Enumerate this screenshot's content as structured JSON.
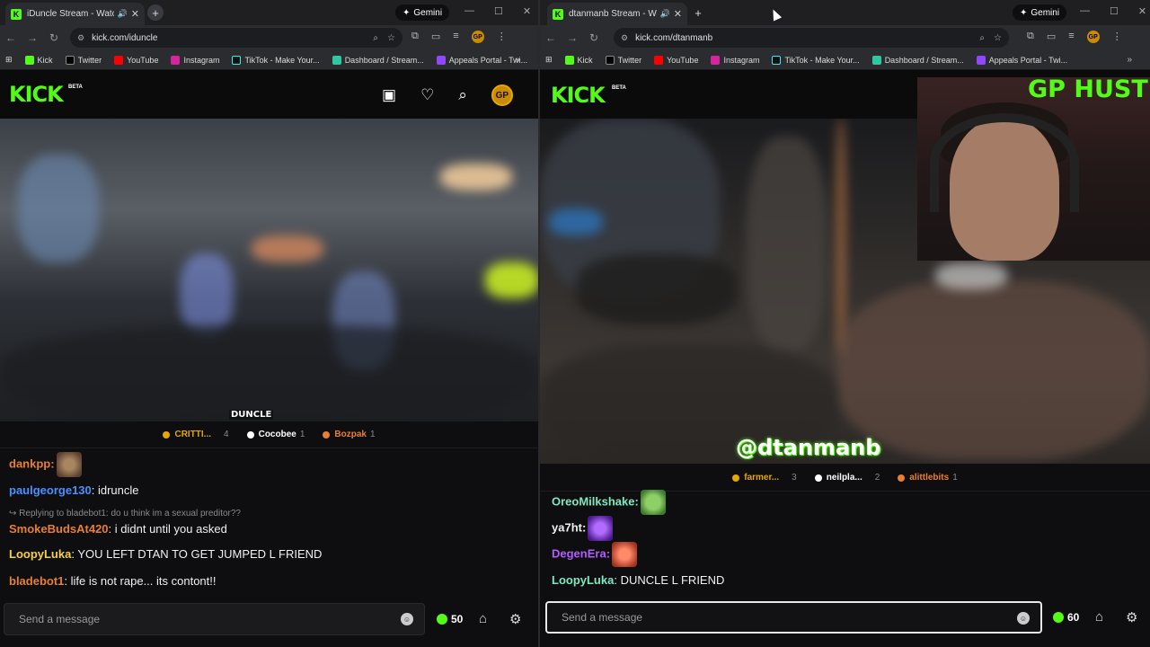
{
  "left": {
    "tab": {
      "title": "iDuncle Stream - Watch Live",
      "favicon": "K"
    },
    "gemini": "Gemini",
    "url": "kick.com/iduncle",
    "bookmarks": [
      "Kick",
      "Twitter",
      "YouTube",
      "Instagram",
      "TikTok - Make Your...",
      "Dashboard / Stream...",
      "Appeals Portal - Twi..."
    ],
    "logo": "KICK",
    "beta": "BETA",
    "watermark": "DUNCLE",
    "top_chatters": [
      {
        "name": "CRITTI...",
        "count": "4",
        "color": "#e6a700"
      },
      {
        "name": "Cocobee",
        "count": "1",
        "color": "#ffffff"
      },
      {
        "name": "Bozpak",
        "count": "1",
        "color": "#e87f2c"
      }
    ],
    "chat": [
      {
        "user": "dankpp:",
        "text": "",
        "color": "#e87f2c",
        "emote": true
      },
      {
        "user": "paulgeorge130",
        "text": ": idruncle",
        "color": "#4a90ff"
      },
      {
        "reply": "Replying to bladebot1: do u think im a sexual preditor??"
      },
      {
        "user": "SmokeBudsAt420",
        "text": ": i didnt until you asked",
        "color": "#e87f2c"
      },
      {
        "user": "LoopyLuka",
        "text": ": YOU LEFT DTAN TO GET JUMPED L FRIEND",
        "color": "#f5d142"
      },
      {
        "user": "bladebot1",
        "text": ": life is not rape... its contont!!",
        "color": "#e87f2c"
      }
    ],
    "input_placeholder": "Send a message",
    "points": "50"
  },
  "right": {
    "tab": {
      "title": "dtanmanb Stream - Watch Live",
      "favicon": "K"
    },
    "gemini": "Gemini",
    "url": "kick.com/dtanmanb",
    "bookmarks": [
      "Kick",
      "Twitter",
      "YouTube",
      "Instagram",
      "TikTok - Make Your...",
      "Dashboard / Stream...",
      "Appeals Portal - Twi..."
    ],
    "logo": "KICK",
    "beta": "BETA",
    "overlay_text": "GP HUSTLA",
    "watermark": "@dtanmanb",
    "top_chatters": [
      {
        "name": "farmer...",
        "count": "3",
        "color": "#e6a700"
      },
      {
        "name": "neilpla...",
        "count": "2",
        "color": "#ffffff"
      },
      {
        "name": "alittlebits",
        "count": "1",
        "color": "#e87f2c"
      }
    ],
    "chat": [
      {
        "user": "OreoMilkshake:",
        "text": "",
        "color": "#7ee8c0",
        "emote": true
      },
      {
        "user": "ya7ht:",
        "text": "",
        "color": "#f0f0f0",
        "emote": true
      },
      {
        "user": "DegenEra:",
        "text": "",
        "color": "#b05cff",
        "emote": true
      },
      {
        "user": "LoopyLuka",
        "text": ": DUNCLE L FRIEND",
        "color": "#7ee8c0"
      }
    ],
    "input_placeholder": "Send a message",
    "points": "60"
  }
}
